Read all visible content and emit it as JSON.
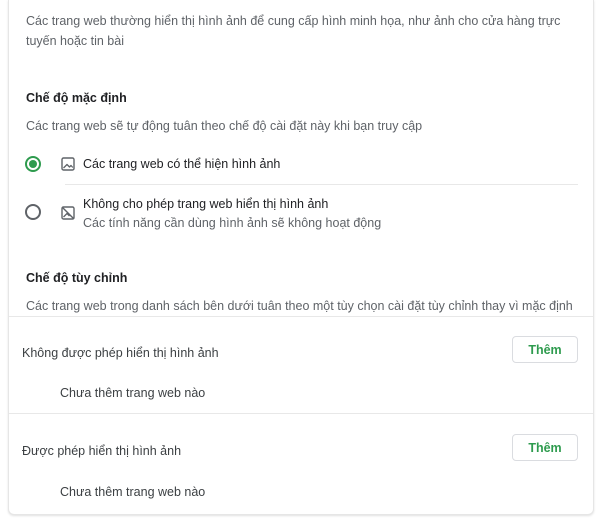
{
  "intro": {
    "description": "Các trang web thường hiển thị hình ảnh để cung cấp hình minh họa, như ảnh cho cửa hàng trực tuyến hoặc tin bài"
  },
  "default_mode": {
    "title": "Chế độ mặc định",
    "subtitle": "Các trang web sẽ tự động tuân theo chế độ cài đặt này khi bạn truy cập",
    "options": [
      {
        "label": "Các trang web có thể hiện hình ảnh",
        "sublabel": "",
        "icon": "image-icon",
        "selected": true
      },
      {
        "label": "Không cho phép trang web hiển thị hình ảnh",
        "sublabel": "Các tính năng cần dùng hình ảnh sẽ không hoạt động",
        "icon": "image-off-icon",
        "selected": false
      }
    ]
  },
  "custom_mode": {
    "title": "Chế độ tùy chỉnh",
    "subtitle": "Các trang web trong danh sách bên dưới tuân theo một tùy chọn cài đặt tùy chỉnh thay vì mặc định",
    "lists": [
      {
        "label": "Không được phép hiển thị hình ảnh",
        "add_button": "Thêm",
        "empty_text": "Chưa thêm trang web nào"
      },
      {
        "label": "Được phép hiển thị hình ảnh",
        "add_button": "Thêm",
        "empty_text": "Chưa thêm trang web nào"
      }
    ]
  },
  "colors": {
    "accent": "#2e9b4e",
    "text_primary": "#202124",
    "text_secondary": "#5f6368",
    "divider": "#e8e8e8"
  }
}
